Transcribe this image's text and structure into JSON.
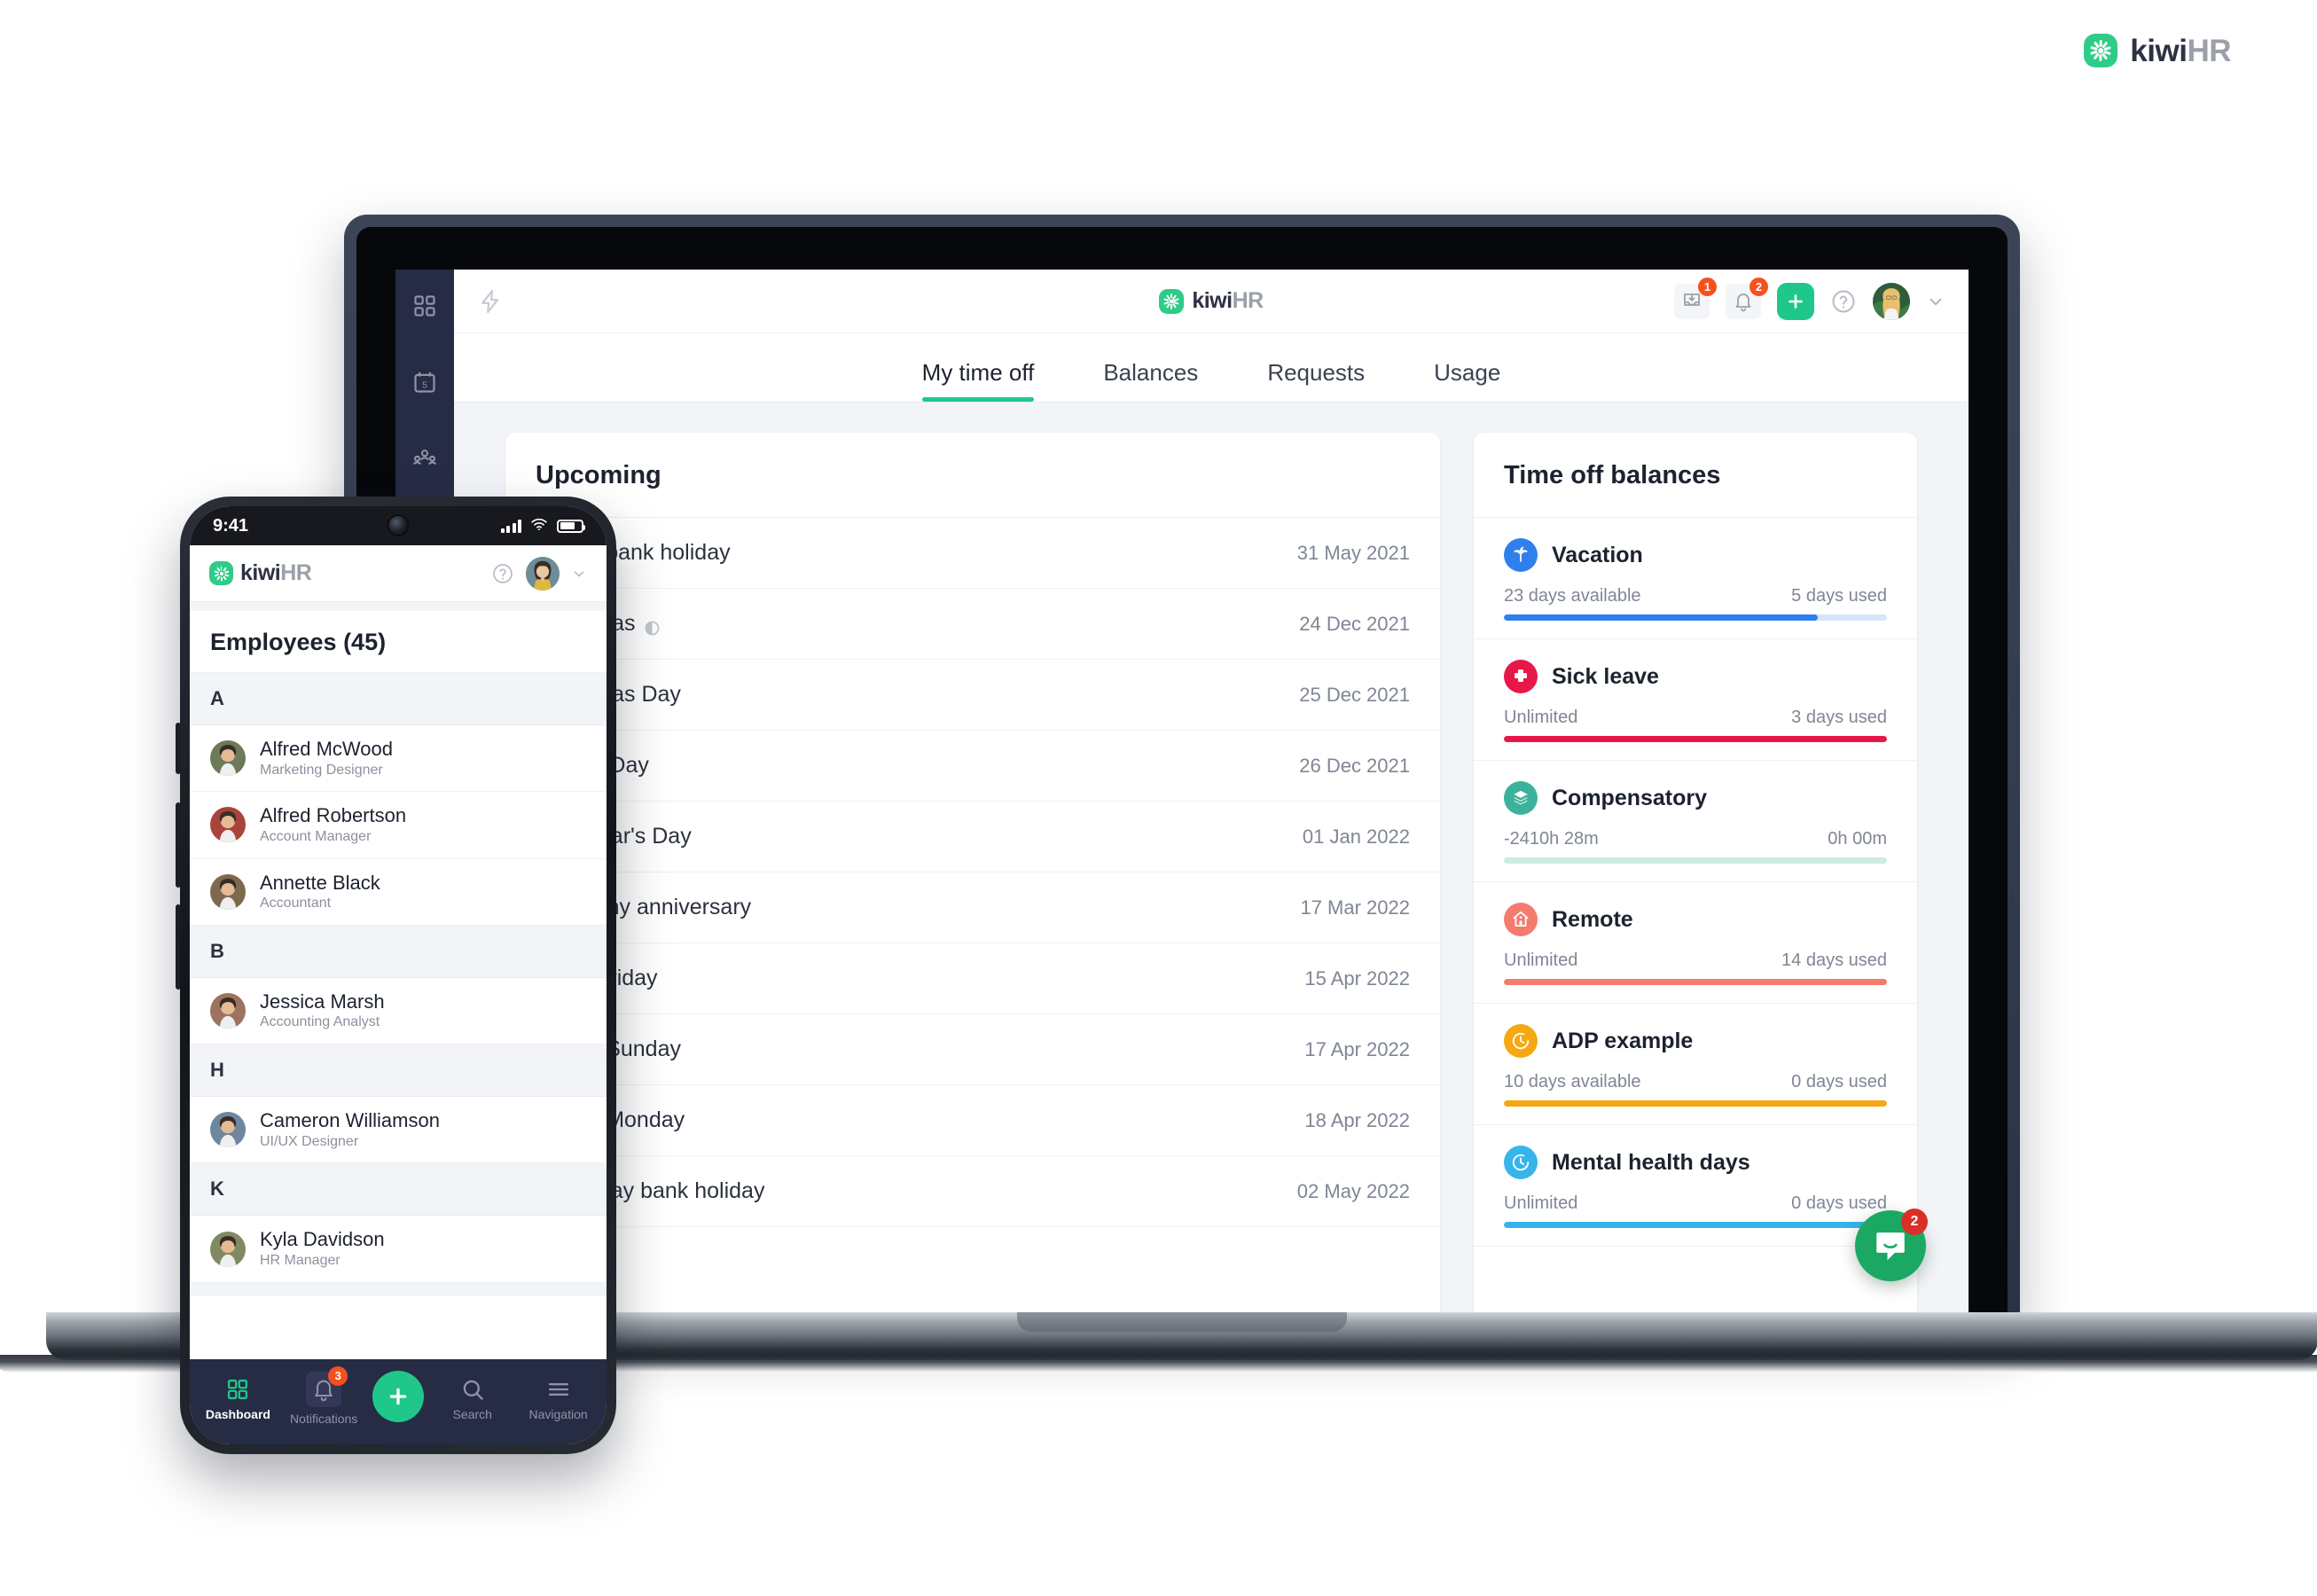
{
  "brand": {
    "word1": "kiwi",
    "word2": "HR",
    "green": "#2ecc87"
  },
  "desktop": {
    "sidebar": [
      {
        "icon": "grid-icon",
        "name": "sidebar-item-dashboard"
      },
      {
        "icon": "calendar-icon",
        "name": "sidebar-item-calendar",
        "day": "5"
      },
      {
        "icon": "people-icon",
        "name": "sidebar-item-employees"
      }
    ],
    "header": {
      "bolt_icon": "lightning-bolt-icon",
      "inbox_badge": "1",
      "bell_badge": "2",
      "plus_label": "+",
      "help_icon": "question-mark-icon",
      "chevron_icon": "chevron-down-icon"
    },
    "tabs": [
      {
        "label": "My time off",
        "active": true
      },
      {
        "label": "Balances",
        "active": false
      },
      {
        "label": "Requests",
        "active": false
      },
      {
        "label": "Usage",
        "active": false
      }
    ],
    "upcoming": {
      "title": "Upcoming",
      "rows": [
        {
          "name": "Spring bank holiday",
          "date": "31 May 2021",
          "half": false
        },
        {
          "name": "Christmas",
          "date": "24 Dec 2021",
          "half": true
        },
        {
          "name": "Christmas Day",
          "date": "25 Dec 2021",
          "half": false
        },
        {
          "name": "Boxing Day",
          "date": "26 Dec 2021",
          "half": false
        },
        {
          "name": "New Year's Day",
          "date": "01 Jan 2022",
          "half": false
        },
        {
          "name": "Company anniversary",
          "date": "17 Mar 2022",
          "half": false
        },
        {
          "name": "Good Friday",
          "date": "15 Apr 2022",
          "half": false
        },
        {
          "name": "Easter Sunday",
          "date": "17 Apr 2022",
          "half": false
        },
        {
          "name": "Easter Monday",
          "date": "18 Apr 2022",
          "half": false
        },
        {
          "name": "Early May bank holiday",
          "date": "02 May 2022",
          "half": false
        }
      ]
    },
    "balances": {
      "title": "Time off balances",
      "rows": [
        {
          "name": "Vacation",
          "available": "23 days available",
          "used": "5 days used",
          "percent": 82,
          "color": "#2f80ed",
          "track": "#d7e5fb",
          "icon": "palm-tree-icon"
        },
        {
          "name": "Sick leave",
          "available": "Unlimited",
          "used": "3 days used",
          "percent": 100,
          "color": "#e8174a",
          "track": "#fadbe3",
          "icon": "medical-cross-icon"
        },
        {
          "name": "Compensatory",
          "available": "-2410h 28m",
          "used": "0h 00m",
          "percent": 100,
          "color": "#cdeae3",
          "track": "#e8f5f2",
          "icon": "layers-icon"
        },
        {
          "name": "Remote",
          "available": "Unlimited",
          "used": "14 days used",
          "percent": 100,
          "color": "#f47b6e",
          "track": "#fbdfdb",
          "icon": "house-icon"
        },
        {
          "name": "ADP example",
          "available": "10 days available",
          "used": "0 days used",
          "percent": 100,
          "color": "#f5a811",
          "track": "#fbe8c3",
          "icon": "clock-icon"
        },
        {
          "name": "Mental health days",
          "available": "Unlimited",
          "used": "0 days used",
          "percent": 100,
          "color": "#36b4ec",
          "track": "#cfeafa",
          "icon": "clock-icon"
        }
      ]
    },
    "intercom": {
      "badge": "2",
      "icon": "chat-bubble-icon"
    }
  },
  "phone": {
    "status": {
      "time": "9:41"
    },
    "header": {
      "help_icon": "question-mark-icon",
      "chevron_icon": "chevron-down-icon"
    },
    "page_title": "Employees (45)",
    "sections": [
      {
        "letter": "A",
        "employees": [
          {
            "name": "Alfred McWood",
            "role": "Marketing Designer",
            "avatar": "#6b7a58"
          },
          {
            "name": "Alfred Robertson",
            "role": "Account Manager",
            "avatar": "#a8443c"
          },
          {
            "name": "Annette Black",
            "role": "Accountant",
            "avatar": "#7d6a4e"
          }
        ]
      },
      {
        "letter": "B",
        "employees": [
          {
            "name": "Jessica Marsh",
            "role": "Accounting Analyst",
            "avatar": "#9c7260"
          }
        ]
      },
      {
        "letter": "H",
        "employees": [
          {
            "name": "Cameron Williamson",
            "role": "UI/UX Designer",
            "avatar": "#6f86a0"
          }
        ]
      },
      {
        "letter": "K",
        "employees": [
          {
            "name": "Kyla Davidson",
            "role": "HR Manager",
            "avatar": "#7f8a63"
          }
        ]
      }
    ],
    "nav": [
      {
        "label": "Dashboard",
        "icon": "grid-icon",
        "active": true,
        "badge": ""
      },
      {
        "label": "Notifications",
        "icon": "bell-icon",
        "active": false,
        "badge": "3"
      },
      {
        "label": "Search",
        "icon": "search-icon",
        "active": false,
        "badge": ""
      },
      {
        "label": "Navigation",
        "icon": "hamburger-menu-icon",
        "active": false,
        "badge": ""
      }
    ],
    "fab": {
      "icon": "plus-icon"
    }
  }
}
